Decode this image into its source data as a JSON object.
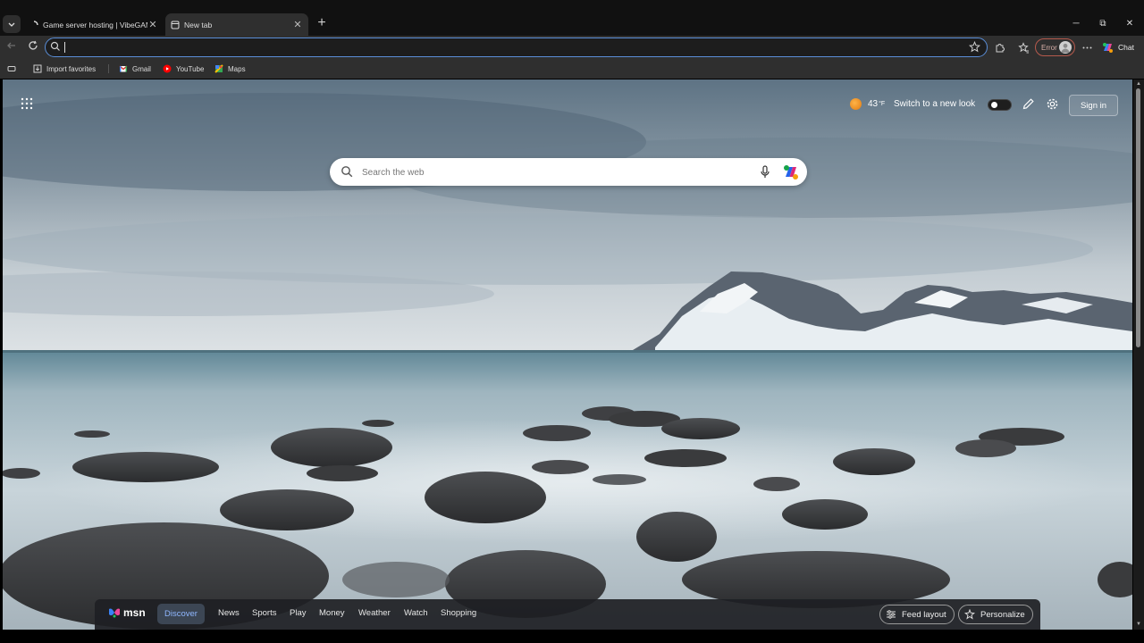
{
  "browser": {
    "tabs": [
      {
        "title": "Game server hosting | VibeGAMES",
        "active": false,
        "loading": true
      },
      {
        "title": "New tab",
        "active": true
      }
    ],
    "tab_close_glyph": "✕",
    "new_tab_glyph": "+",
    "window_controls": {
      "minimize": "─",
      "maximize": "⧉",
      "close": "✕"
    },
    "address_bar": {
      "value": "",
      "placeholder": ""
    },
    "profile_error_label": "Error",
    "chat_label": "Chat"
  },
  "bookmarks": [
    {
      "label": "Import favorites",
      "icon": "import-icon"
    },
    {
      "label": "Gmail",
      "icon": "gmail-icon"
    },
    {
      "label": "YouTube",
      "icon": "youtube-icon"
    },
    {
      "label": "Maps",
      "icon": "maps-icon"
    }
  ],
  "newtab": {
    "weather": {
      "temperature": "43",
      "unit": "°F"
    },
    "switch_label": "Switch to a new look",
    "switch_on": false,
    "sign_in_label": "Sign in",
    "search_placeholder": "Search the web"
  },
  "msn": {
    "logo_text": "msn",
    "nav": [
      "Discover",
      "News",
      "Sports",
      "Play",
      "Money",
      "Weather",
      "Watch",
      "Shopping"
    ],
    "active_nav": "Discover",
    "feed_layout_label": "Feed layout",
    "personalize_label": "Personalize"
  },
  "colors": {
    "accent_blue": "#5a8ed8",
    "error_red": "#b65a4d",
    "active_nav_text": "#8fb7ff"
  }
}
